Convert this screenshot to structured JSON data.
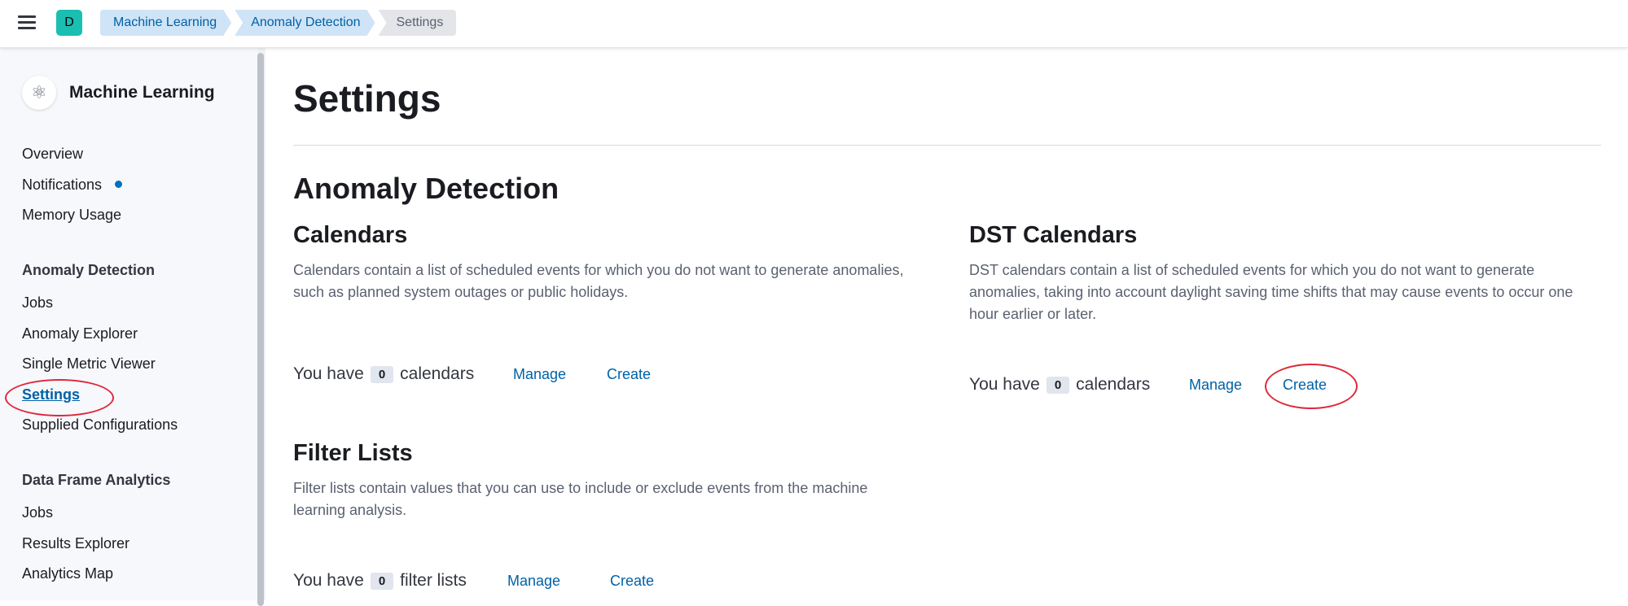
{
  "header": {
    "space_initial": "D",
    "breadcrumbs": [
      "Machine Learning",
      "Anomaly Detection",
      "Settings"
    ]
  },
  "sidebar": {
    "title": "Machine Learning",
    "top_items": [
      "Overview",
      "Notifications",
      "Memory Usage"
    ],
    "groups": [
      {
        "label": "Anomaly Detection",
        "items": [
          "Jobs",
          "Anomaly Explorer",
          "Single Metric Viewer",
          "Settings",
          "Supplied Configurations"
        ]
      },
      {
        "label": "Data Frame Analytics",
        "items": [
          "Jobs",
          "Results Explorer",
          "Analytics Map"
        ]
      }
    ],
    "active_item": "Settings"
  },
  "main": {
    "page_title": "Settings",
    "section_title": "Anomaly Detection",
    "calendars": {
      "title": "Calendars",
      "description": "Calendars contain a list of scheduled events for which you do not want to generate anomalies, such as planned system outages or public holidays.",
      "count_prefix": "You have",
      "count": "0",
      "count_suffix": "calendars",
      "manage": "Manage",
      "create": "Create"
    },
    "dst_calendars": {
      "title": "DST Calendars",
      "description": "DST calendars contain a list of scheduled events for which you do not want to generate anomalies, taking into account daylight saving time shifts that may cause events to occur one hour earlier or later.",
      "count_prefix": "You have",
      "count": "0",
      "count_suffix": "calendars",
      "manage": "Manage",
      "create": "Create"
    },
    "filter_lists": {
      "title": "Filter Lists",
      "description": "Filter lists contain values that you can use to include or exclude events from the machine learning analysis.",
      "count_prefix": "You have",
      "count": "0",
      "count_suffix": "filter lists",
      "manage": "Manage",
      "create": "Create"
    }
  },
  "colors": {
    "accent": "#0061a6",
    "space_avatar": "#1bbfb2",
    "highlight_ring": "#e0263a",
    "notification_dot": "#0070c0"
  },
  "icons": [
    "hamburger-menu-icon",
    "ml-app-logo-icon"
  ]
}
